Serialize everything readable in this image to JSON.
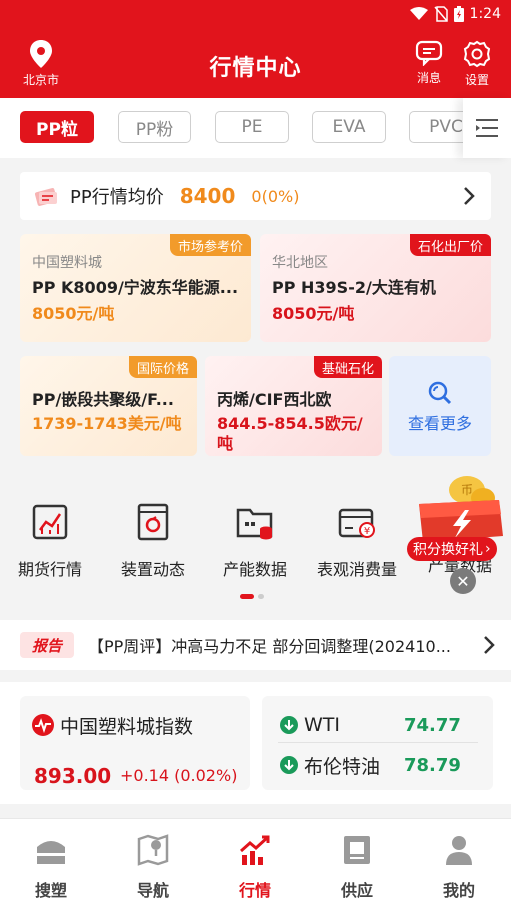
{
  "status_bar": {
    "time": "1:24"
  },
  "header": {
    "title": "行情中心",
    "location": "北京市",
    "messages_label": "消息",
    "settings_label": "设置",
    "bg_color": "#e1141c"
  },
  "category_tabs": [
    "PP粒",
    "PP粉",
    "PE",
    "EVA",
    "PVC"
  ],
  "avg_price": {
    "label": "PP行情均价",
    "price": "8400",
    "change": "0(0%)"
  },
  "quote_cards": [
    {
      "tag": "市场参考价",
      "region": "中国塑料城",
      "name": "PP K8009/宁波东华能源...",
      "price": "8050元/吨"
    },
    {
      "tag": "石化出厂价",
      "region": "华北地区",
      "name": "PP H39S-2/大连有机",
      "price": "8050元/吨"
    },
    {
      "tag": "国际价格",
      "name": "PP/嵌段共聚级/F...",
      "price": "1739-1743美元/吨"
    },
    {
      "tag": "基础石化",
      "name": "丙烯/CIF西北欧",
      "price_line1": "844.5-854.5欧元/",
      "price_line2": "吨"
    }
  ],
  "more_label": "查看更多",
  "shortcuts": [
    "期货行情",
    "装置动态",
    "产能数据",
    "表观消费量",
    "产量数据"
  ],
  "promo": {
    "label": "积分换好礼"
  },
  "report": {
    "badge": "报告",
    "text": "【PP周评】冲高马力不足 部分回调整理(202410..."
  },
  "index": {
    "title": "中国塑料城指数",
    "value": "893.00",
    "change": "+0.14 (0.02%)"
  },
  "oil": [
    {
      "name": "WTI",
      "value": "74.77"
    },
    {
      "name": "布伦特油",
      "value": "78.79"
    }
  ],
  "bottom_nav": [
    "搜塑",
    "导航",
    "行情",
    "供应",
    "我的"
  ],
  "active_nav": "行情"
}
